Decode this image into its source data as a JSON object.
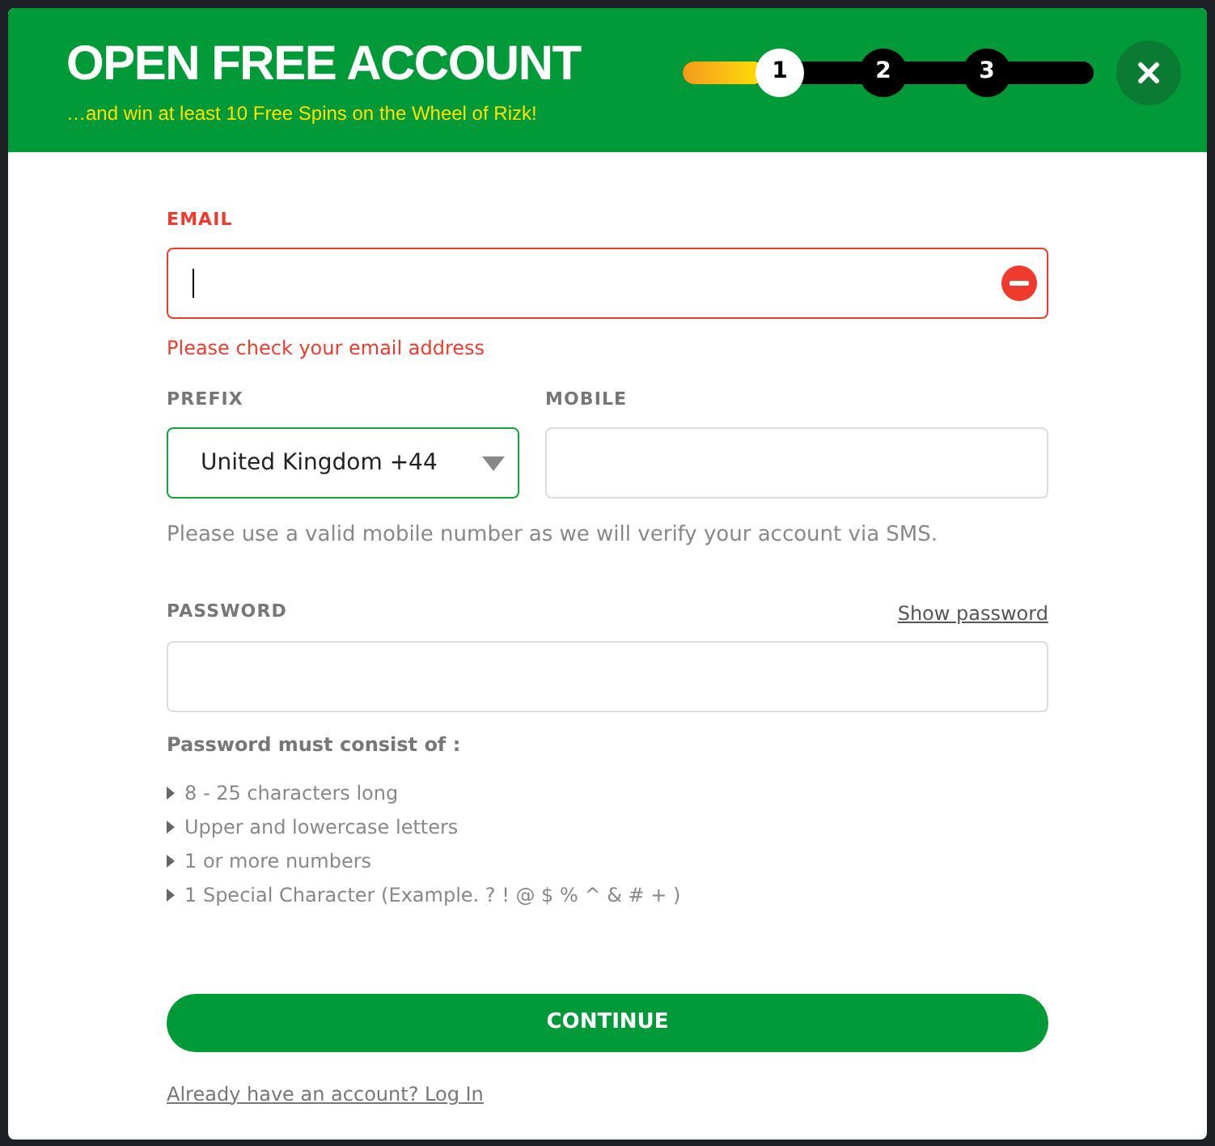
{
  "header": {
    "title": "OPEN FREE ACCOUNT",
    "subtitle": "…and win at least 10 Free Spins on the Wheel of Rizk!"
  },
  "progress": {
    "level": 0.2,
    "steps": [
      {
        "label": "1",
        "selected": true
      },
      {
        "label": "2",
        "selected": false
      },
      {
        "label": "3",
        "selected": false
      }
    ]
  },
  "email": {
    "label": "EMAIL",
    "error": true,
    "message": "Please check your email address"
  },
  "prefix": {
    "label": "PREFIX",
    "value": "United Kingdom +44",
    "focused": true
  },
  "mobile": {
    "label": "MOBILE",
    "hint": "Please use a valid mobile number as we will verify your account via SMS."
  },
  "password": {
    "label": "PASSWORD",
    "toggle": "Show password",
    "rules_title": "Password must consist of :",
    "rules": [
      "8 - 25 characters long",
      "Upper and lowercase letters",
      "1 or more numbers",
      "1 Special Character (Example. ? ! @ $ % ^ & # + )"
    ]
  },
  "continue_button": "CONTINUE",
  "login_link": "Already have an account? Log In"
}
